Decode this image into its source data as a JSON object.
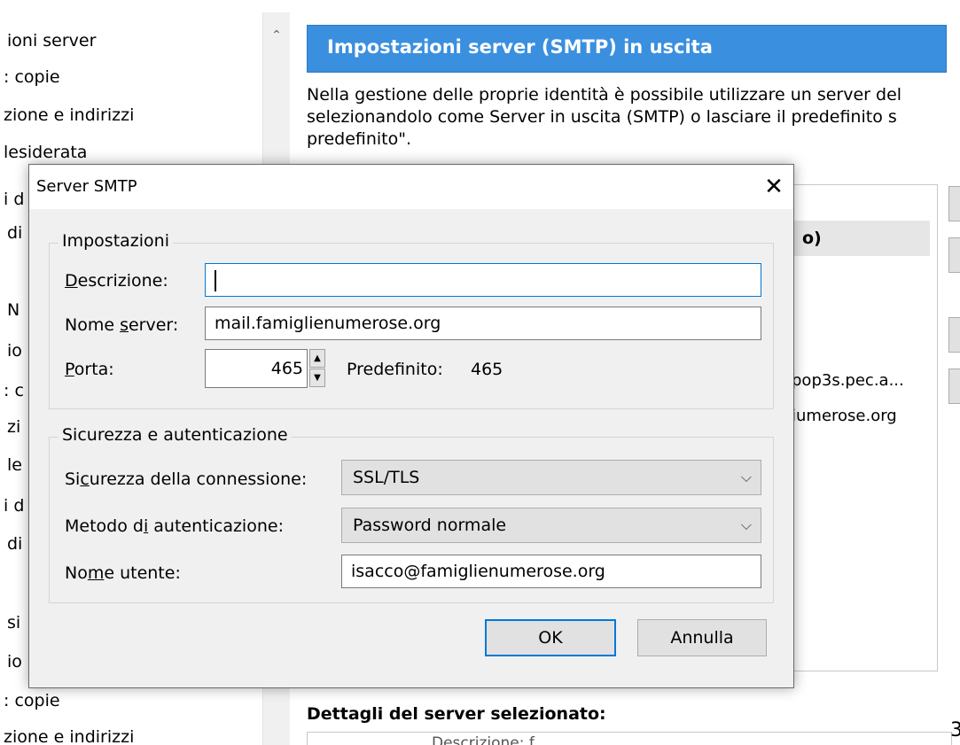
{
  "background": {
    "left_list": {
      "items": [
        "ioni server",
        ": copie",
        "zione e indirizzi",
        "lesiderata",
        "i d",
        "di",
        "N",
        "io",
        ": c",
        "zi",
        "le",
        "i d",
        "di",
        "si",
        "io",
        ": copie",
        "zione e indirizzi"
      ],
      "scroll_up_glyph": "⌃"
    },
    "right": {
      "header_title": "Impostazioni server (SMTP) in uscita",
      "paragraph_lines": [
        "Nella gestione delle proprie identità è possibile utilizzare un server del",
        "selezionandolo come Server in uscita (SMTP) o lasciare il predefinito s",
        "predefinito\"."
      ],
      "server_list": {
        "header_fragment": "o)",
        "rows": [
          "pop3s.pec.a...",
          "iumerose.org"
        ]
      },
      "details_title": "Dettagli del server selezionato:",
      "details_partial": "Descrizione: f",
      "edge_char": "3"
    }
  },
  "dialog": {
    "title": "Server SMTP",
    "close_glyph": "✕",
    "settings_group": {
      "legend": "Impostazioni",
      "description_label_pre": "",
      "description_label_ul": "D",
      "description_label_post": "escrizione:",
      "description_value": "",
      "server_label_pre": "Nome ",
      "server_label_ul": "s",
      "server_label_post": "erver:",
      "server_value": "mail.famiglienumerose.org",
      "port_label_pre": "",
      "port_label_ul": "P",
      "port_label_post": "orta:",
      "port_value": "465",
      "spin_up": "▲",
      "spin_down": "▼",
      "default_label": "Predefinito:",
      "default_value": "465"
    },
    "security_group": {
      "legend": "Sicurezza e autenticazione",
      "conn_label_pre": "Si",
      "conn_label_ul": "c",
      "conn_label_post": "urezza della connessione:",
      "conn_value": "SSL/TLS",
      "auth_label_pre": "Metodo d",
      "auth_label_ul": "i",
      "auth_label_post": " autenticazione:",
      "auth_value": "Password normale",
      "user_label_pre": "No",
      "user_label_ul": "m",
      "user_label_post": "e utente:",
      "user_value": "isacco@famiglienumerose.org",
      "chevron": "⌵"
    },
    "ok_label": "OK",
    "cancel_label": "Annulla"
  },
  "colors": {
    "header_blue": "#3a8fdf",
    "focus_blue": "#0078d7",
    "dialog_bg": "#f0f0f0"
  }
}
